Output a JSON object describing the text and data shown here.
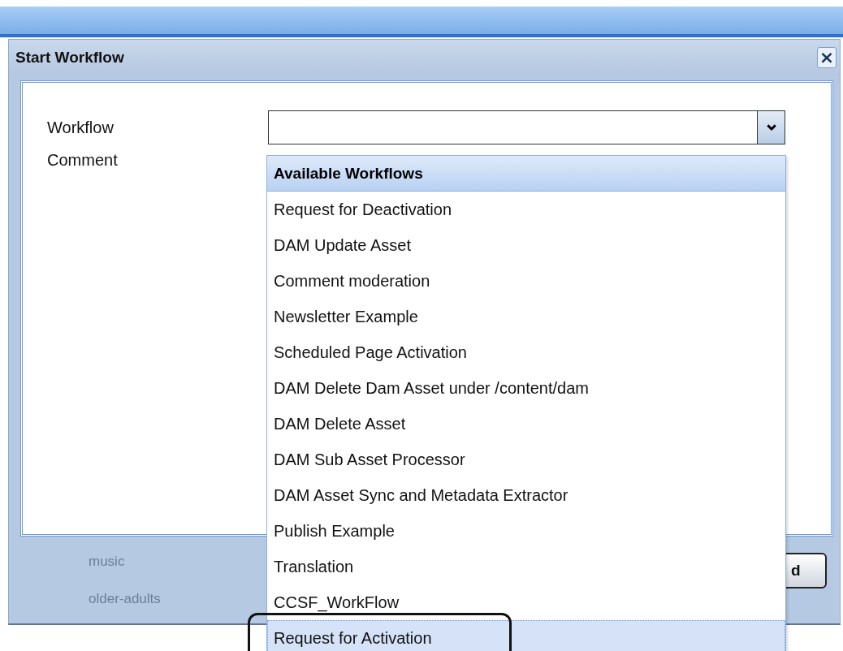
{
  "dialog": {
    "title": "Start Workflow",
    "close": "×"
  },
  "form": {
    "fields": [
      {
        "label": "Workflow",
        "kind": "combo",
        "caret": "⌄"
      },
      {
        "label": "Comment",
        "kind": "text"
      }
    ]
  },
  "dropdown": {
    "header": "Available Workflows",
    "items": [
      {
        "label": "Request for Deactivation",
        "selected": false,
        "highlighted": false
      },
      {
        "label": "DAM Update Asset",
        "selected": false,
        "highlighted": false
      },
      {
        "label": "Comment moderation",
        "selected": false,
        "highlighted": false
      },
      {
        "label": "Newsletter Example",
        "selected": false,
        "highlighted": false
      },
      {
        "label": "Scheduled Page Activation",
        "selected": false,
        "highlighted": false
      },
      {
        "label": "DAM Delete Dam Asset under /content/dam",
        "selected": false,
        "highlighted": false
      },
      {
        "label": "DAM Delete Asset",
        "selected": false,
        "highlighted": false
      },
      {
        "label": "DAM Sub Asset Processor",
        "selected": false,
        "highlighted": false
      },
      {
        "label": "DAM Asset Sync and Metadata Extractor",
        "selected": false,
        "highlighted": false
      },
      {
        "label": "Publish Example",
        "selected": false,
        "highlighted": false
      },
      {
        "label": "Translation",
        "selected": false,
        "highlighted": false
      },
      {
        "label": "CCSF_WorkFlow",
        "selected": false,
        "highlighted": false
      },
      {
        "label": "Request for Activation",
        "selected": true,
        "highlighted": true
      }
    ]
  },
  "background_items": [
    "music",
    "older-adults"
  ],
  "footer_button": {
    "label": "d"
  }
}
